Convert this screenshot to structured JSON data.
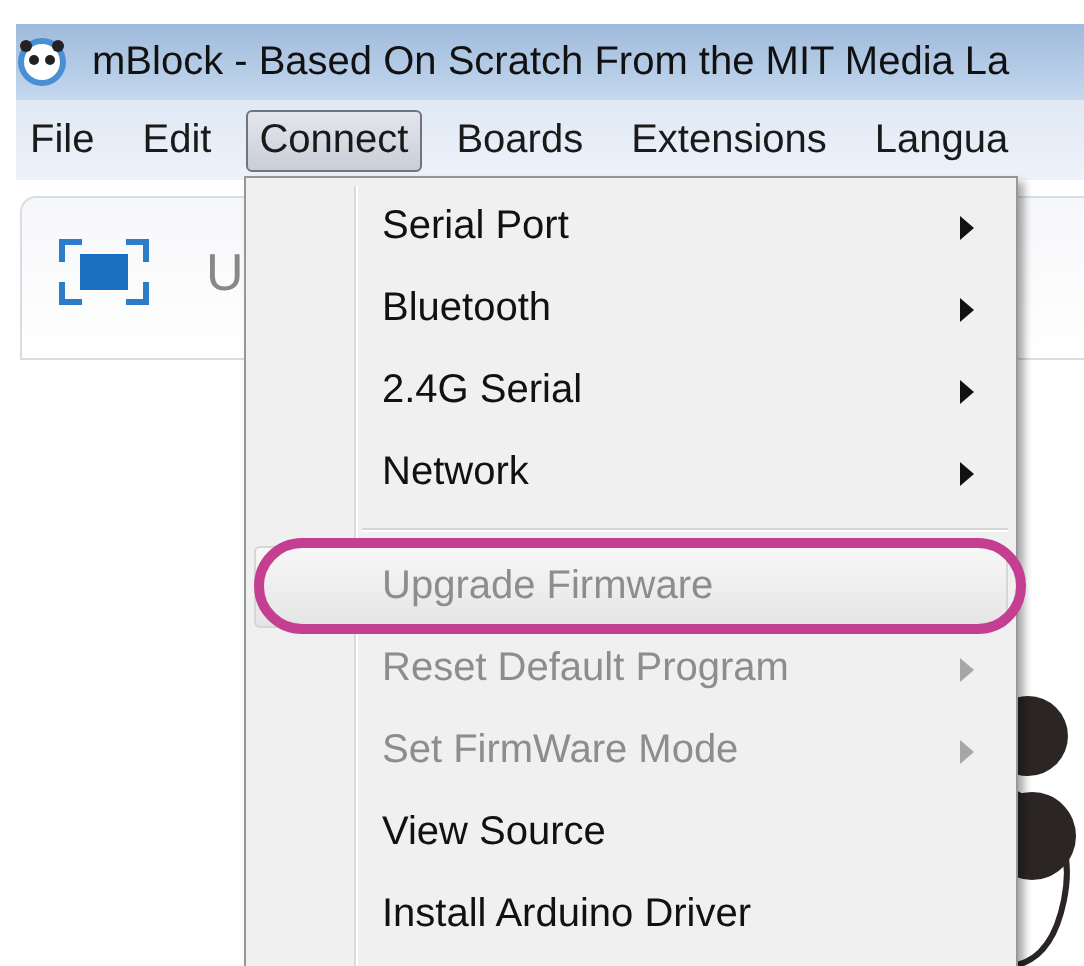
{
  "window": {
    "title": "mBlock - Based On Scratch From the MIT Media La"
  },
  "menubar": [
    {
      "label": "File",
      "selected": false
    },
    {
      "label": "Edit",
      "selected": false
    },
    {
      "label": "Connect",
      "selected": true
    },
    {
      "label": "Boards",
      "selected": false
    },
    {
      "label": "Extensions",
      "selected": false
    },
    {
      "label": "Langua",
      "selected": false
    }
  ],
  "toolbar": {
    "label": "U"
  },
  "menu": {
    "items": [
      {
        "kind": "submenu",
        "label": "Serial Port",
        "disabled": false,
        "selected": false
      },
      {
        "kind": "submenu",
        "label": "Bluetooth",
        "disabled": false,
        "selected": false
      },
      {
        "kind": "submenu",
        "label": "2.4G Serial",
        "disabled": false,
        "selected": false
      },
      {
        "kind": "submenu",
        "label": "Network",
        "disabled": false,
        "selected": false
      },
      {
        "kind": "separator"
      },
      {
        "kind": "action",
        "label": "Upgrade Firmware",
        "disabled": true,
        "selected": true,
        "circled": true
      },
      {
        "kind": "submenu",
        "label": "Reset Default Program",
        "disabled": true,
        "selected": false
      },
      {
        "kind": "submenu",
        "label": "Set FirmWare Mode",
        "disabled": true,
        "selected": false
      },
      {
        "kind": "action",
        "label": "View Source",
        "disabled": false,
        "selected": false
      },
      {
        "kind": "action",
        "label": "Install Arduino Driver",
        "disabled": false,
        "selected": false
      }
    ]
  }
}
